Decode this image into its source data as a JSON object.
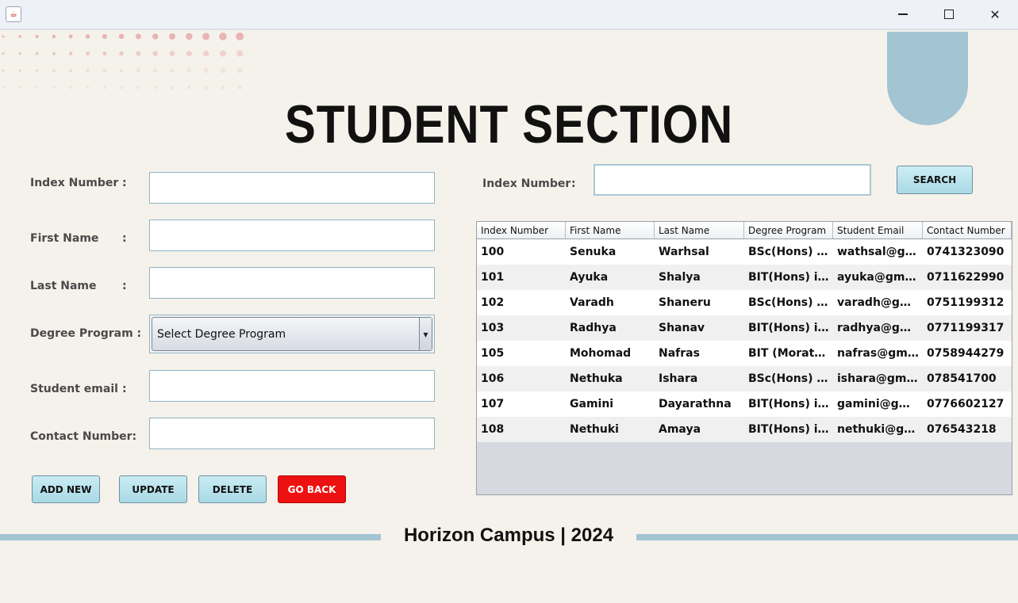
{
  "window": {
    "app_icon": "java-icon",
    "minimize_icon": "minimize-icon",
    "maximize_icon": "maximize-icon",
    "close_icon": "close-icon"
  },
  "page": {
    "title": "STUDENT SECTION"
  },
  "form": {
    "index_label": "Index Number",
    "first_name_label": "First Name",
    "last_name_label": "Last Name",
    "degree_label": "Degree Program :",
    "email_label": "Student email",
    "contact_label": "Contact Number:",
    "colon": ":",
    "index_value": "",
    "first_name_value": "",
    "last_name_value": "",
    "email_value": "",
    "contact_value": "",
    "degree_selected": "Select Degree Program"
  },
  "buttons": {
    "add_new": "ADD NEW",
    "update": "UPDATE",
    "delete": "DELETE",
    "go_back": "GO BACK"
  },
  "search": {
    "label": "Index Number",
    "colon": ":",
    "value": "",
    "button": "SEARCH"
  },
  "table": {
    "columns": [
      "Index Number",
      "First Name",
      "Last Name",
      "Degree Program",
      "Student Email",
      "Contact Number"
    ],
    "rows": [
      [
        "100",
        "Senuka",
        "Warhsal",
        "BSc(Hons) in...",
        "wathsal@gm...",
        "0741323090"
      ],
      [
        "101",
        "Ayuka",
        "Shalya",
        "BIT(Hons) in...",
        "ayuka@gmail...",
        "0711622990"
      ],
      [
        "102",
        "Varadh",
        "Shaneru",
        "BSc(Hons) in...",
        "varadh@gma...",
        "0751199312"
      ],
      [
        "103",
        "Radhya",
        "Shanav",
        "BIT(Hons) in...",
        "radhya@gma...",
        "0771199317"
      ],
      [
        "105",
        "Mohomad",
        "Nafras",
        "BIT (Moratu...",
        "nafras@gmai...",
        "0758944279"
      ],
      [
        "106",
        "Nethuka",
        "Ishara",
        "BSc(Hons) in...",
        "ishara@gmail...",
        "078541700"
      ],
      [
        "107",
        "Gamini",
        "Dayarathna",
        "BIT(Hons) in...",
        "gamini@gmai...",
        "0776602127"
      ],
      [
        "108",
        "Nethuki",
        "Amaya",
        "BIT(Hons) in...",
        "nethuki@gm...",
        "076543218"
      ]
    ]
  },
  "footer": {
    "text": "Horizon Campus | 2024"
  },
  "colors": {
    "background": "#f5f2eb",
    "accent_blue": "#a3c4d3",
    "button_blue": "#b6e2ec",
    "danger_red": "#ee1111",
    "dot_color": "#e8b4b4"
  }
}
